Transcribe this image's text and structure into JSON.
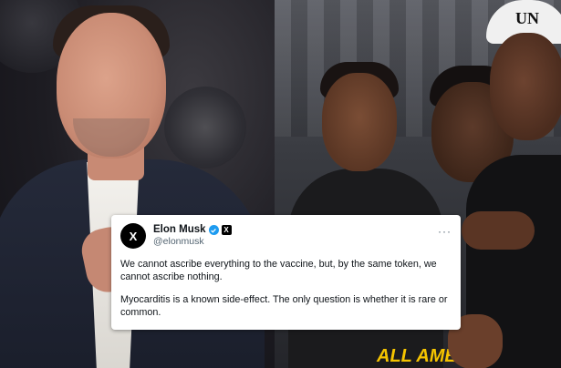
{
  "tweet": {
    "avatar_glyph": "X",
    "display_name": "Elon Musk",
    "handle": "@elonmusk",
    "verified_icon": "verified-check-icon",
    "affiliation_badge": "X",
    "more_glyph": "···",
    "paragraphs": [
      "We cannot ascribe everything to the vaccine, but, by the same token, we cannot ascribe nothing.",
      "Myocarditis is a known side-effect. The only question is whether it is rare or common."
    ]
  },
  "photos": {
    "right": {
      "cap_text": "UN",
      "jersey_text": "ALL AMERIC"
    }
  },
  "colors": {
    "verified": "#1d9bf0",
    "text": "#0f1419",
    "secondary_text": "#536471",
    "jersey_accent": "#f5c400"
  }
}
